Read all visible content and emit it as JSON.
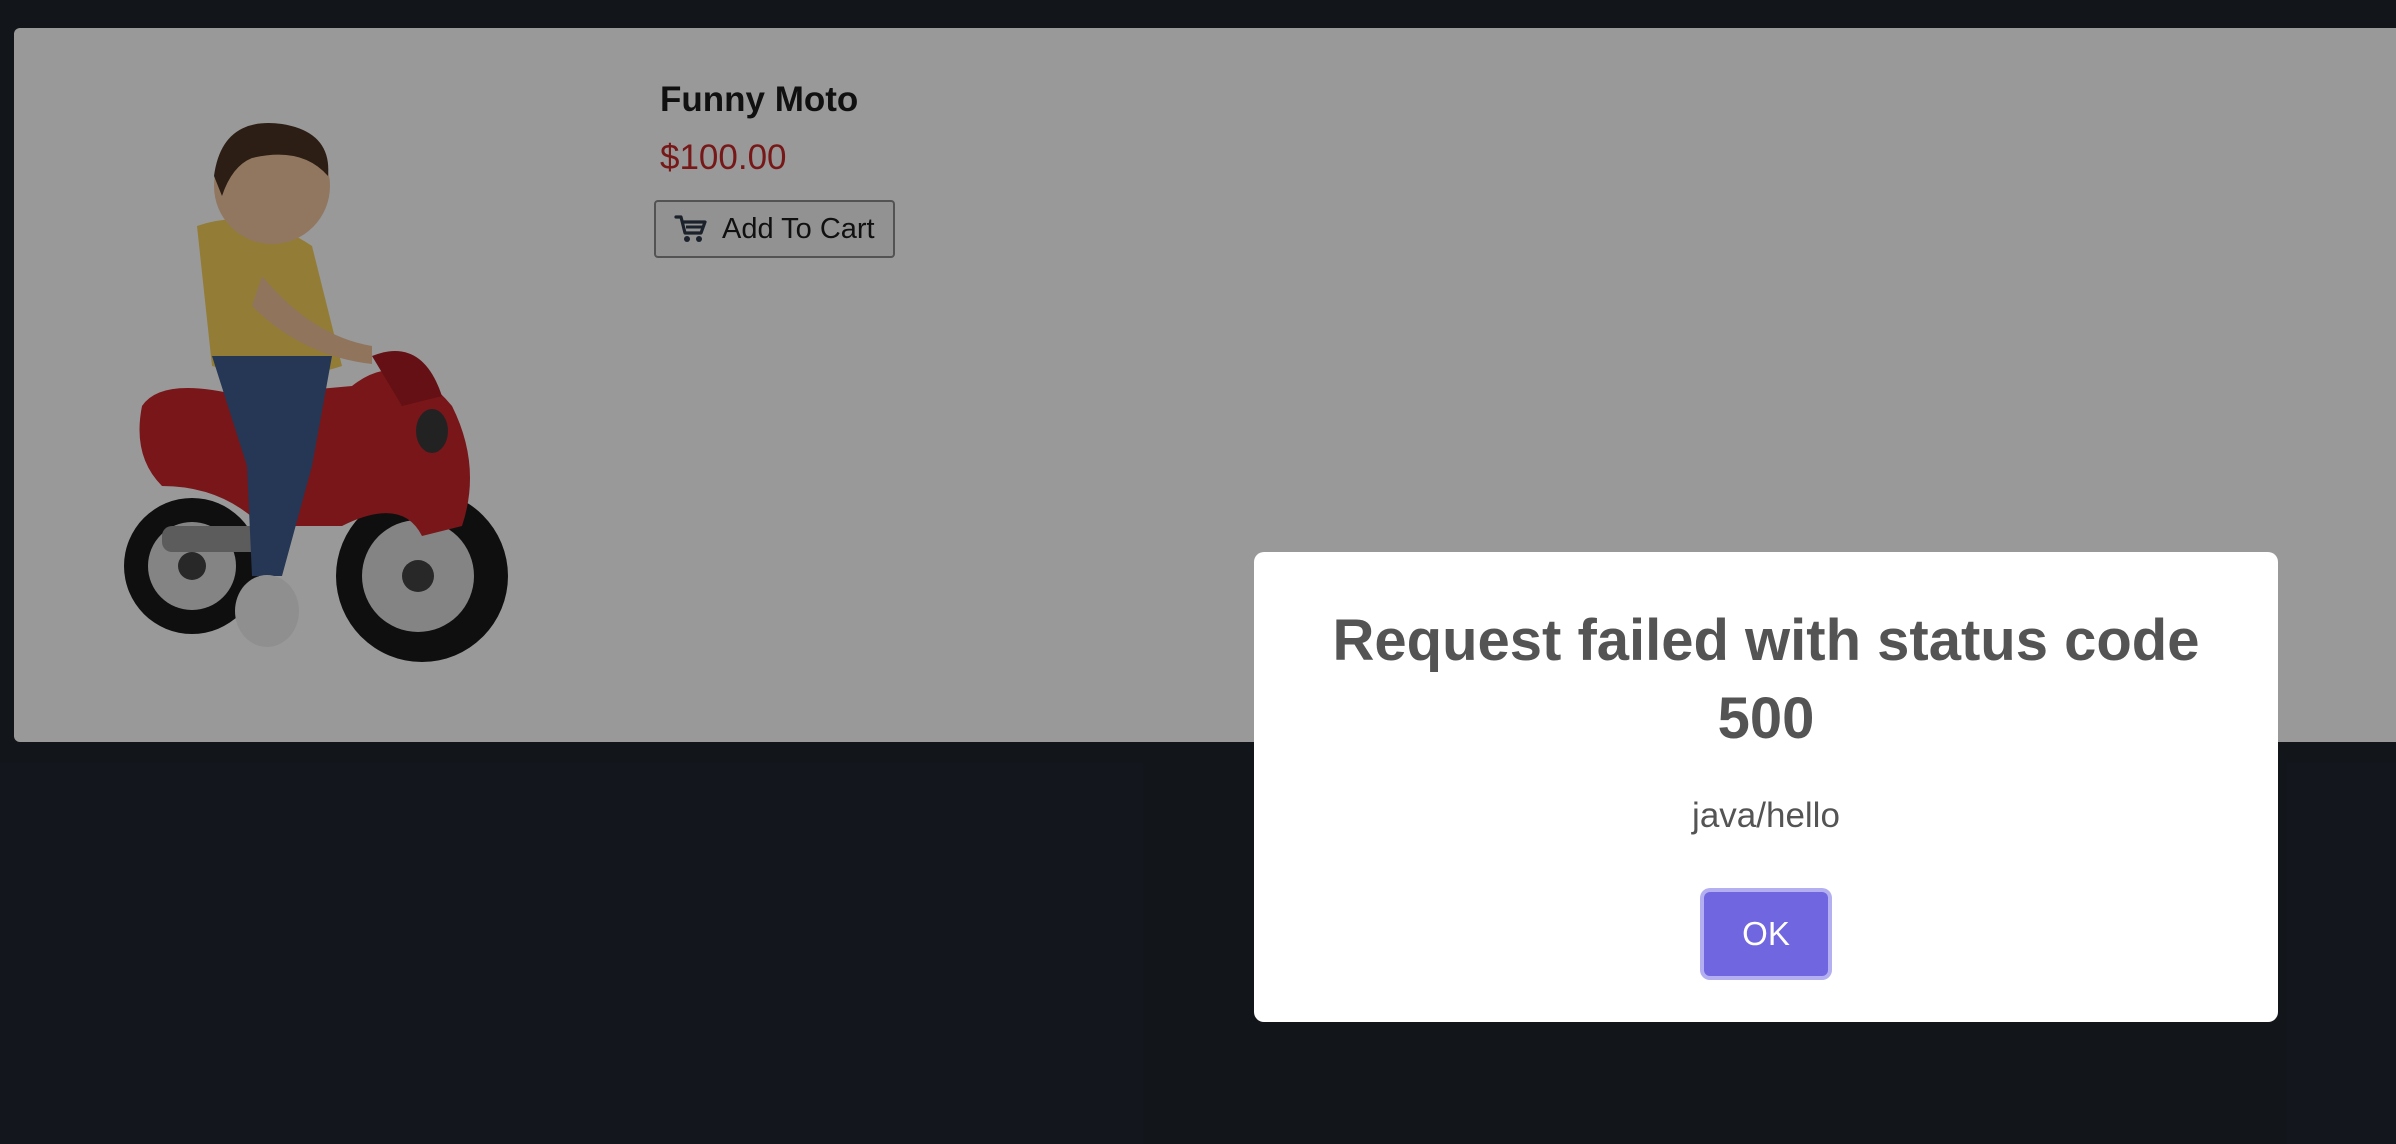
{
  "product": {
    "name": "Funny Moto",
    "price": "$100.00",
    "add_to_cart_label": "Add To Cart",
    "image_alt": "Child riding a red toy motorcycle",
    "cart_icon": "cart-icon"
  },
  "dialog": {
    "title": "Request failed with status code 500",
    "text": "java/hello",
    "ok_label": "OK"
  },
  "colors": {
    "background": "#1f252e",
    "price": "#c62828",
    "ok_button": "#7066e0"
  }
}
